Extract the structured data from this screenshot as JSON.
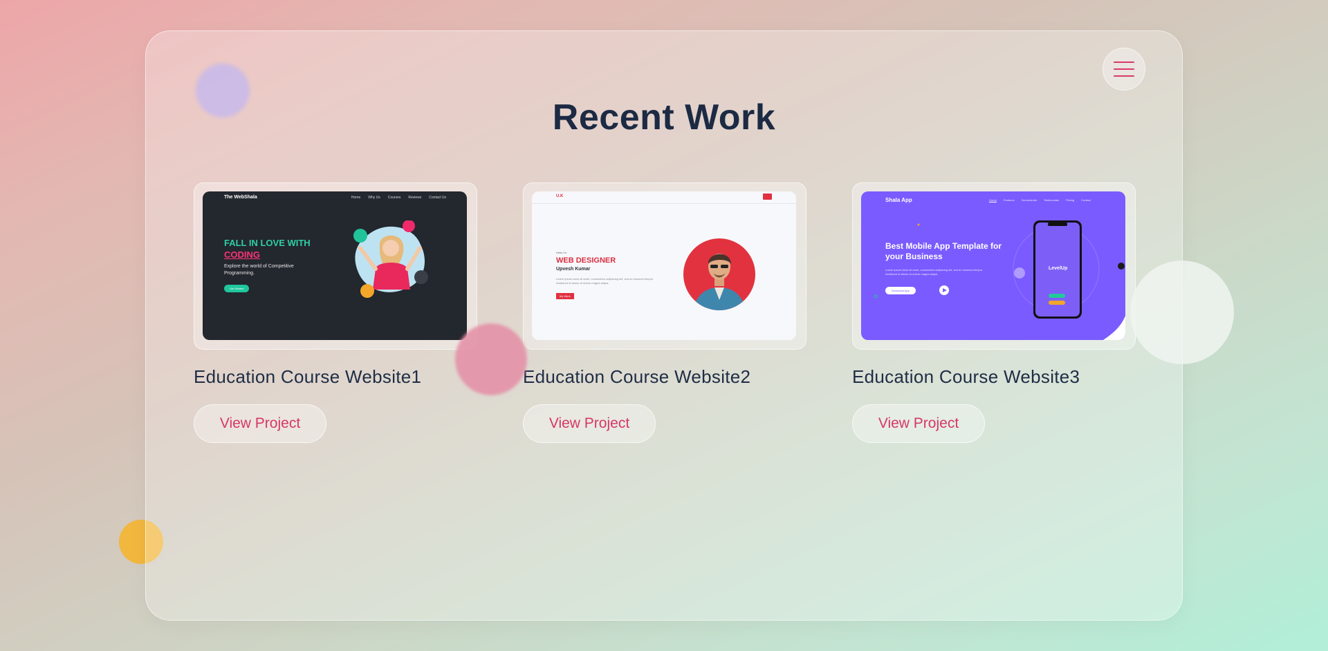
{
  "page": {
    "title": "Recent Work"
  },
  "menu": {
    "icon": "hamburger-icon"
  },
  "colors": {
    "accent": "#d63766",
    "title": "#1c2a43"
  },
  "projects": [
    {
      "title": "Education Course Website1",
      "button": "View Project",
      "preview": {
        "logo": "The WebShala",
        "nav": [
          "Home",
          "Why Us",
          "Courses",
          "Reviews",
          "Contact Us"
        ],
        "heading_line1": "FALL IN LOVE WITH",
        "heading_line2": "CODING",
        "subtitle": "Explore the world of Competitive Programming.",
        "cta": "Get Started"
      }
    },
    {
      "title": "Education Course Website2",
      "button": "View Project",
      "preview": {
        "logo": "U.K",
        "greeting": "Hello I'm",
        "role": "WEB DESIGNER",
        "name": "Upvesh Kumar",
        "description": "Lorem ipsum dolor sit amet, consectetur adipiscing elit, sed do eiusmod tempor incididunt ut labore et dolore magna aliqua.",
        "cta": "My Work"
      }
    },
    {
      "title": "Education Course Website3",
      "button": "View Project",
      "preview": {
        "logo": "Shala App",
        "nav": [
          "Home",
          "Features",
          "Screenshots",
          "Testimonials",
          "Pricing",
          "Contact"
        ],
        "heading": "Best Mobile App Template for your Business",
        "description": "Lorem ipsum dolor sit amet, consectetur adipiscing elit, sed do eiusmod tempor incididunt ut labore et dolore magna aliqua",
        "cta": "Download App",
        "phone_brand": "LevelUp"
      }
    }
  ]
}
